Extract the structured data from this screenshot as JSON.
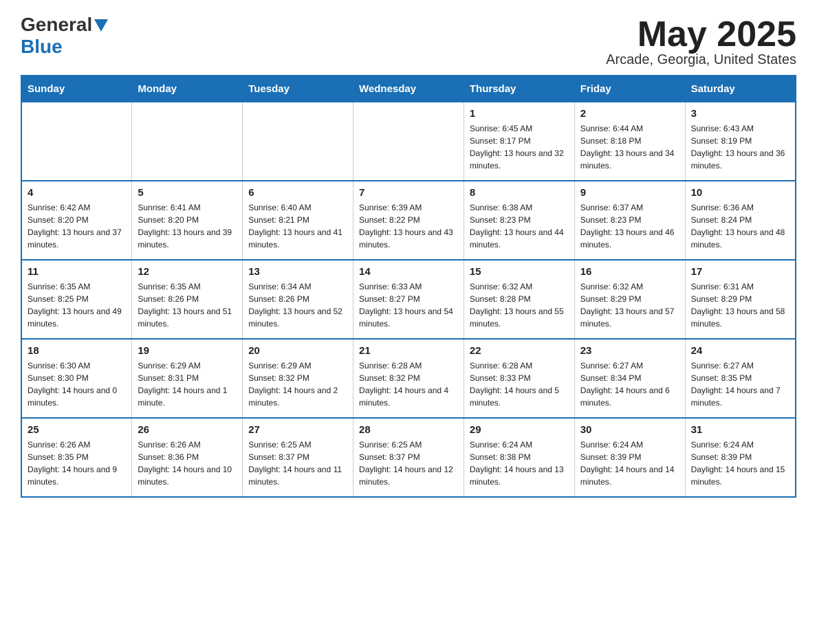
{
  "header": {
    "logo_general": "General",
    "logo_blue": "Blue",
    "month_title": "May 2025",
    "location": "Arcade, Georgia, United States"
  },
  "days_of_week": [
    "Sunday",
    "Monday",
    "Tuesday",
    "Wednesday",
    "Thursday",
    "Friday",
    "Saturday"
  ],
  "weeks": [
    [
      {
        "day": "",
        "sunrise": "",
        "sunset": "",
        "daylight": ""
      },
      {
        "day": "",
        "sunrise": "",
        "sunset": "",
        "daylight": ""
      },
      {
        "day": "",
        "sunrise": "",
        "sunset": "",
        "daylight": ""
      },
      {
        "day": "",
        "sunrise": "",
        "sunset": "",
        "daylight": ""
      },
      {
        "day": "1",
        "sunrise": "Sunrise: 6:45 AM",
        "sunset": "Sunset: 8:17 PM",
        "daylight": "Daylight: 13 hours and 32 minutes."
      },
      {
        "day": "2",
        "sunrise": "Sunrise: 6:44 AM",
        "sunset": "Sunset: 8:18 PM",
        "daylight": "Daylight: 13 hours and 34 minutes."
      },
      {
        "day": "3",
        "sunrise": "Sunrise: 6:43 AM",
        "sunset": "Sunset: 8:19 PM",
        "daylight": "Daylight: 13 hours and 36 minutes."
      }
    ],
    [
      {
        "day": "4",
        "sunrise": "Sunrise: 6:42 AM",
        "sunset": "Sunset: 8:20 PM",
        "daylight": "Daylight: 13 hours and 37 minutes."
      },
      {
        "day": "5",
        "sunrise": "Sunrise: 6:41 AM",
        "sunset": "Sunset: 8:20 PM",
        "daylight": "Daylight: 13 hours and 39 minutes."
      },
      {
        "day": "6",
        "sunrise": "Sunrise: 6:40 AM",
        "sunset": "Sunset: 8:21 PM",
        "daylight": "Daylight: 13 hours and 41 minutes."
      },
      {
        "day": "7",
        "sunrise": "Sunrise: 6:39 AM",
        "sunset": "Sunset: 8:22 PM",
        "daylight": "Daylight: 13 hours and 43 minutes."
      },
      {
        "day": "8",
        "sunrise": "Sunrise: 6:38 AM",
        "sunset": "Sunset: 8:23 PM",
        "daylight": "Daylight: 13 hours and 44 minutes."
      },
      {
        "day": "9",
        "sunrise": "Sunrise: 6:37 AM",
        "sunset": "Sunset: 8:23 PM",
        "daylight": "Daylight: 13 hours and 46 minutes."
      },
      {
        "day": "10",
        "sunrise": "Sunrise: 6:36 AM",
        "sunset": "Sunset: 8:24 PM",
        "daylight": "Daylight: 13 hours and 48 minutes."
      }
    ],
    [
      {
        "day": "11",
        "sunrise": "Sunrise: 6:35 AM",
        "sunset": "Sunset: 8:25 PM",
        "daylight": "Daylight: 13 hours and 49 minutes."
      },
      {
        "day": "12",
        "sunrise": "Sunrise: 6:35 AM",
        "sunset": "Sunset: 8:26 PM",
        "daylight": "Daylight: 13 hours and 51 minutes."
      },
      {
        "day": "13",
        "sunrise": "Sunrise: 6:34 AM",
        "sunset": "Sunset: 8:26 PM",
        "daylight": "Daylight: 13 hours and 52 minutes."
      },
      {
        "day": "14",
        "sunrise": "Sunrise: 6:33 AM",
        "sunset": "Sunset: 8:27 PM",
        "daylight": "Daylight: 13 hours and 54 minutes."
      },
      {
        "day": "15",
        "sunrise": "Sunrise: 6:32 AM",
        "sunset": "Sunset: 8:28 PM",
        "daylight": "Daylight: 13 hours and 55 minutes."
      },
      {
        "day": "16",
        "sunrise": "Sunrise: 6:32 AM",
        "sunset": "Sunset: 8:29 PM",
        "daylight": "Daylight: 13 hours and 57 minutes."
      },
      {
        "day": "17",
        "sunrise": "Sunrise: 6:31 AM",
        "sunset": "Sunset: 8:29 PM",
        "daylight": "Daylight: 13 hours and 58 minutes."
      }
    ],
    [
      {
        "day": "18",
        "sunrise": "Sunrise: 6:30 AM",
        "sunset": "Sunset: 8:30 PM",
        "daylight": "Daylight: 14 hours and 0 minutes."
      },
      {
        "day": "19",
        "sunrise": "Sunrise: 6:29 AM",
        "sunset": "Sunset: 8:31 PM",
        "daylight": "Daylight: 14 hours and 1 minute."
      },
      {
        "day": "20",
        "sunrise": "Sunrise: 6:29 AM",
        "sunset": "Sunset: 8:32 PM",
        "daylight": "Daylight: 14 hours and 2 minutes."
      },
      {
        "day": "21",
        "sunrise": "Sunrise: 6:28 AM",
        "sunset": "Sunset: 8:32 PM",
        "daylight": "Daylight: 14 hours and 4 minutes."
      },
      {
        "day": "22",
        "sunrise": "Sunrise: 6:28 AM",
        "sunset": "Sunset: 8:33 PM",
        "daylight": "Daylight: 14 hours and 5 minutes."
      },
      {
        "day": "23",
        "sunrise": "Sunrise: 6:27 AM",
        "sunset": "Sunset: 8:34 PM",
        "daylight": "Daylight: 14 hours and 6 minutes."
      },
      {
        "day": "24",
        "sunrise": "Sunrise: 6:27 AM",
        "sunset": "Sunset: 8:35 PM",
        "daylight": "Daylight: 14 hours and 7 minutes."
      }
    ],
    [
      {
        "day": "25",
        "sunrise": "Sunrise: 6:26 AM",
        "sunset": "Sunset: 8:35 PM",
        "daylight": "Daylight: 14 hours and 9 minutes."
      },
      {
        "day": "26",
        "sunrise": "Sunrise: 6:26 AM",
        "sunset": "Sunset: 8:36 PM",
        "daylight": "Daylight: 14 hours and 10 minutes."
      },
      {
        "day": "27",
        "sunrise": "Sunrise: 6:25 AM",
        "sunset": "Sunset: 8:37 PM",
        "daylight": "Daylight: 14 hours and 11 minutes."
      },
      {
        "day": "28",
        "sunrise": "Sunrise: 6:25 AM",
        "sunset": "Sunset: 8:37 PM",
        "daylight": "Daylight: 14 hours and 12 minutes."
      },
      {
        "day": "29",
        "sunrise": "Sunrise: 6:24 AM",
        "sunset": "Sunset: 8:38 PM",
        "daylight": "Daylight: 14 hours and 13 minutes."
      },
      {
        "day": "30",
        "sunrise": "Sunrise: 6:24 AM",
        "sunset": "Sunset: 8:39 PM",
        "daylight": "Daylight: 14 hours and 14 minutes."
      },
      {
        "day": "31",
        "sunrise": "Sunrise: 6:24 AM",
        "sunset": "Sunset: 8:39 PM",
        "daylight": "Daylight: 14 hours and 15 minutes."
      }
    ]
  ]
}
